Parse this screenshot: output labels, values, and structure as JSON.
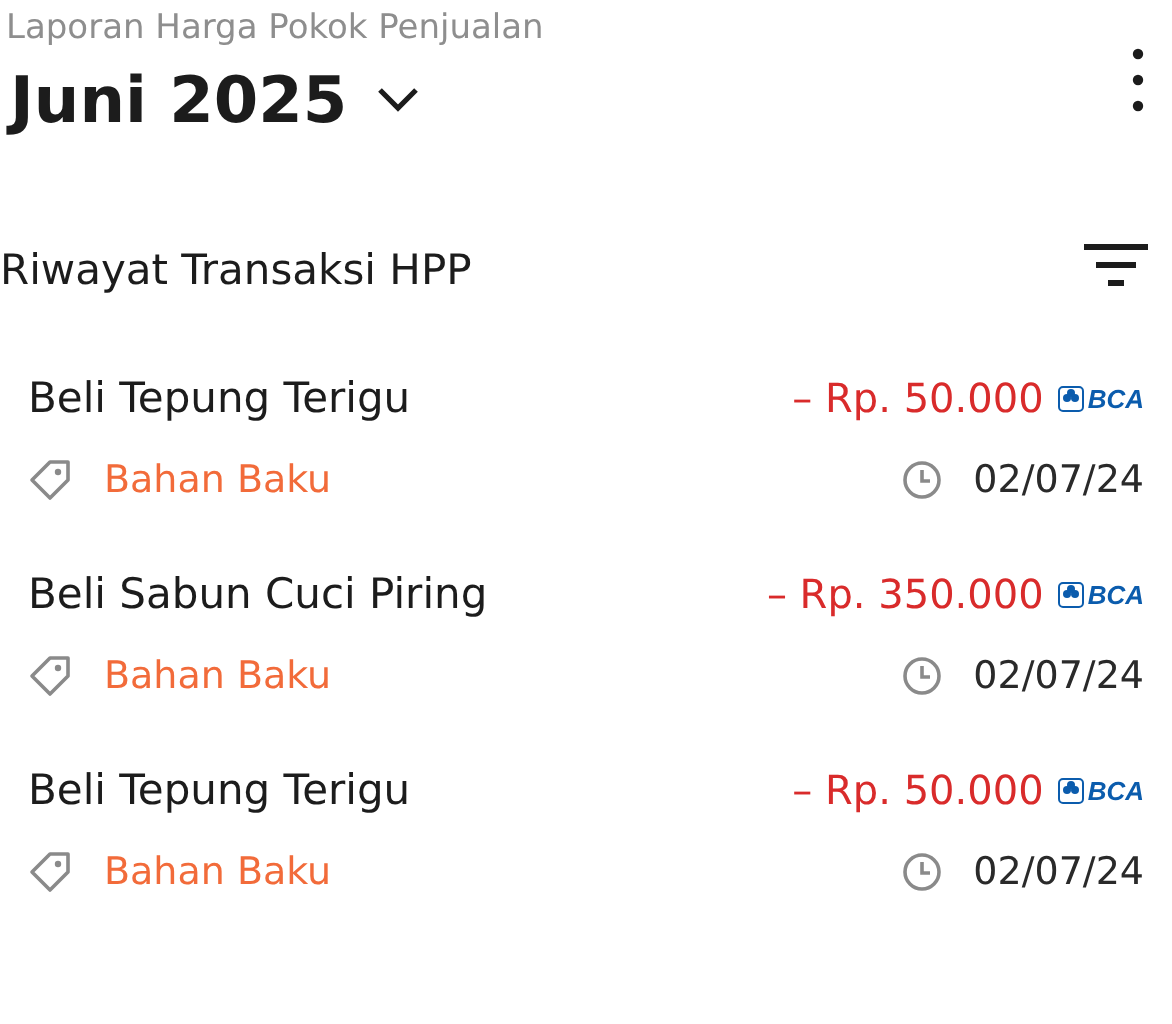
{
  "header": {
    "subtitle": "Laporan Harga Pokok Penjualan",
    "period": "Juni 2025"
  },
  "section": {
    "title": "Riwayat Transaksi HPP"
  },
  "transactions": [
    {
      "name": "Beli Tepung Terigu",
      "amount": "– Rp. 50.000",
      "bank": "BCA",
      "category": "Bahan Baku",
      "date": "02/07/24"
    },
    {
      "name": "Beli Sabun Cuci Piring",
      "amount": "– Rp. 350.000",
      "bank": "BCA",
      "category": "Bahan Baku",
      "date": "02/07/24"
    },
    {
      "name": "Beli Tepung Terigu",
      "amount": "– Rp. 50.000",
      "bank": "BCA",
      "category": "Bahan Baku",
      "date": "02/07/24"
    }
  ]
}
